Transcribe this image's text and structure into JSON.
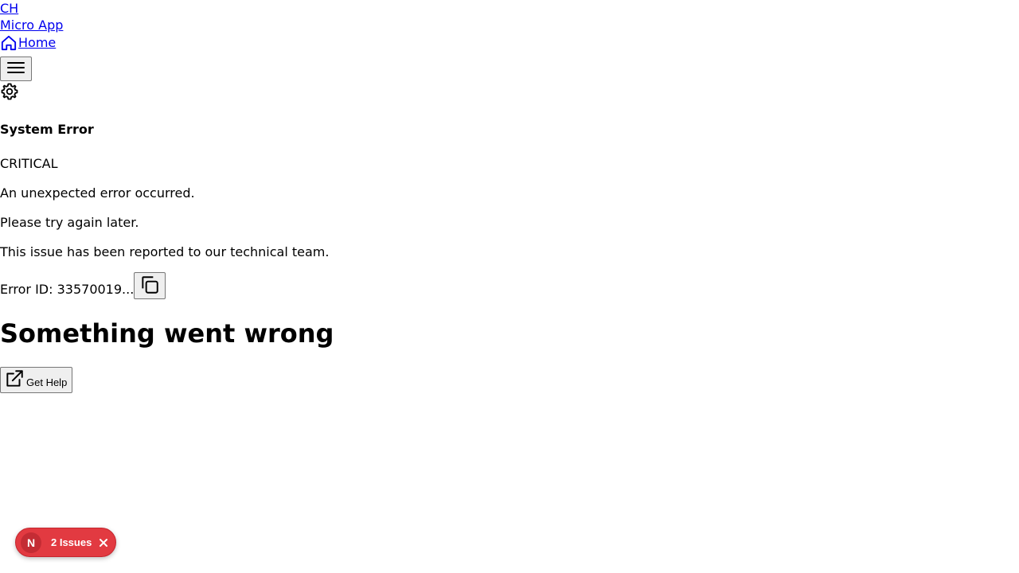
{
  "header": {
    "brand_initials": "CH",
    "brand_name": "Micro App",
    "home_label": "Home",
    "icons": {
      "home": "home-icon",
      "menu": "hamburger-menu-icon",
      "settings": "gear-icon"
    }
  },
  "error": {
    "title": "System Error",
    "severity": "CRITICAL",
    "message": "An unexpected error occurred.",
    "advice": "Please try again later.",
    "report_note": "This issue has been reported to our technical team.",
    "id_label": "Error ID: 33570019...",
    "copy_icon": "copy-icon"
  },
  "main": {
    "heading": "Something went wrong",
    "help_label": "Get Help",
    "help_icon": "external-link-icon"
  },
  "issues_badge": {
    "avatar_letter": "N",
    "count_label": "2 Issues",
    "close_icon": "close-icon",
    "colors": {
      "background": "#e23a41",
      "avatar": "#c42c34"
    }
  }
}
